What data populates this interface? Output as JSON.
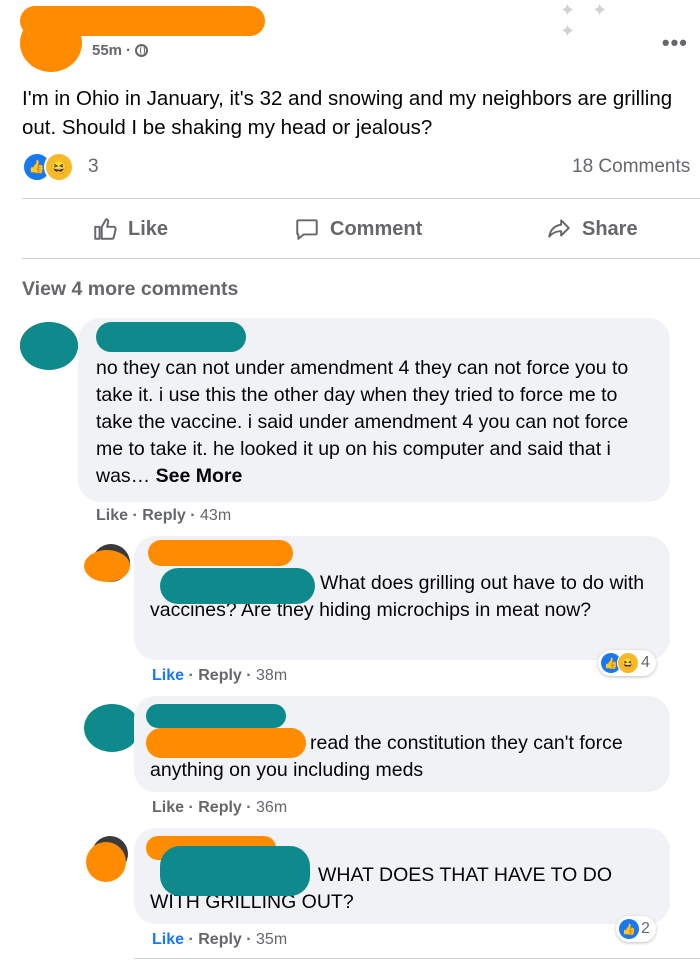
{
  "post": {
    "timestamp": "55m",
    "privacy_icon": "globe-icon",
    "text": "I'm in Ohio in January, it's 32 and snowing and my neighbors are grilling out.  Should I be shaking my head or jealous?",
    "reaction_count": "3",
    "comment_count": "18 Comments",
    "reactions": [
      "like",
      "haha"
    ]
  },
  "actions": {
    "like": "Like",
    "comment": "Comment",
    "share": "Share"
  },
  "view_more": "View 4 more comments",
  "comments": [
    {
      "text": "no they can not under amendment 4 they can not force you to take it. i use this the other day when they tried to force me to take the vaccine. i said under amendment 4 you can not force me to take it. he looked it up on his computer and said that i was…",
      "see_more": "See More",
      "like": "Like",
      "reply": "Reply",
      "time": "43m"
    },
    {
      "text_line1": "What does grilling out have to do",
      "text_rest": "with vaccines? Are they hiding microchips in meat now?",
      "like": "Like",
      "reply": "Reply",
      "time": "38m",
      "reaction_count": "4"
    },
    {
      "text_line1": "read the constitution they can't",
      "text_rest": "force anything on you including meds",
      "like": "Like",
      "reply": "Reply",
      "time": "36m"
    },
    {
      "text_line1": "WHAT DOES THAT HAVE TO",
      "text_rest": "DO WITH GRILLING OUT?",
      "like": "Like",
      "reply": "Reply",
      "time": "35m",
      "reaction_count": "2"
    }
  ],
  "colors": {
    "like_blue": "#1877f2",
    "meta_gray": "#65676b",
    "bubble": "#f0f2f5",
    "redact_orange": "#ff8c00",
    "redact_teal": "#0f8a8c"
  }
}
